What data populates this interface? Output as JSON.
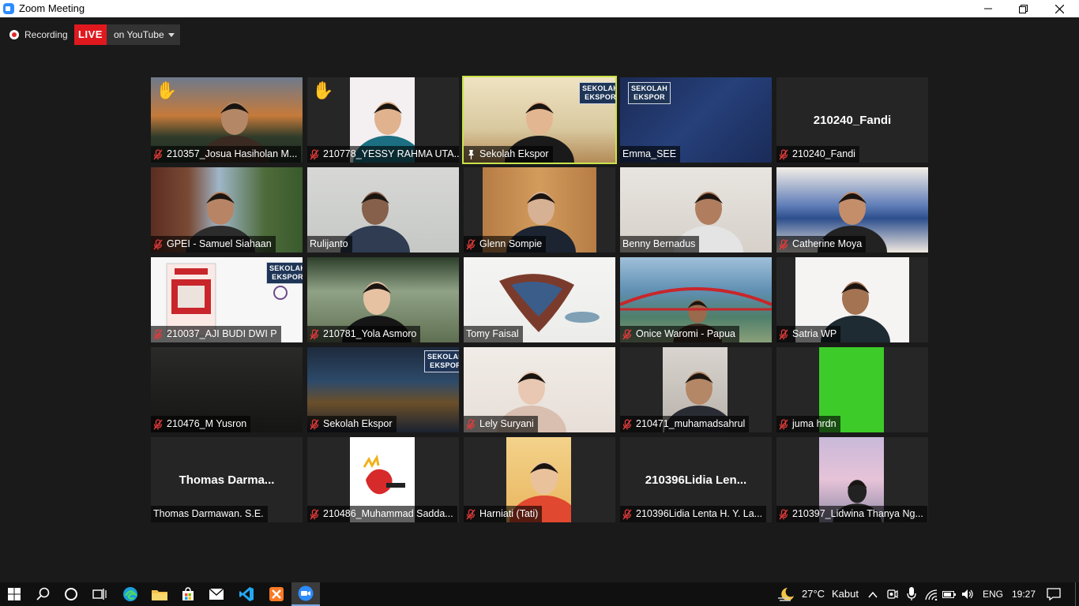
{
  "window": {
    "title": "Zoom Meeting"
  },
  "recording": {
    "label": "Recording",
    "live_badge": "LIVE",
    "stream_target": "on YouTube"
  },
  "tiles": [
    {
      "name": "210357_Josua Hasiholan M...",
      "muted": true,
      "hand_raised": true
    },
    {
      "name": "210778_YESSY RAHMA UTA...",
      "muted": true,
      "hand_raised": true
    },
    {
      "name": "Sekolah Ekspor",
      "pinned": true,
      "active_speaker": true,
      "watermark": [
        "SEKOLAH",
        "EKSPOR"
      ]
    },
    {
      "name": "Emma_SEE",
      "watermark": [
        "SEKOLAH",
        "EKSPOR"
      ]
    },
    {
      "name": "210240_Fandi",
      "muted": true,
      "video_off_label": "210240_Fandi"
    },
    {
      "name": "GPEI - Samuel Siahaan",
      "muted": true
    },
    {
      "name": "Rulijanto"
    },
    {
      "name": "Glenn Sompie",
      "muted": true
    },
    {
      "name": "Benny Bernadus"
    },
    {
      "name": "Catherine Moya",
      "muted": true
    },
    {
      "name": "210037_AJI BUDI DWI P",
      "muted": true,
      "watermark": [
        "SEKOLAH",
        "EKSPOR"
      ]
    },
    {
      "name": "210781_Yola Asmoro",
      "muted": true
    },
    {
      "name": "Tomy Faisal"
    },
    {
      "name": "Onice Waromi - Papua",
      "muted": true
    },
    {
      "name": "Satria WP",
      "muted": true
    },
    {
      "name": "210476_M Yusron",
      "muted": true
    },
    {
      "name": "Sekolah Ekspor",
      "muted": true,
      "watermark": [
        "SEKOLAH",
        "EKSPOR"
      ]
    },
    {
      "name": "Lely Suryani",
      "muted": true
    },
    {
      "name": "210471_muhamadsahrul",
      "muted": true
    },
    {
      "name": "juma hrdn",
      "muted": true
    },
    {
      "name": "Thomas Darmawan. S.E.",
      "video_off_label": "Thomas  Darma..."
    },
    {
      "name": "210486_Muhammad Sadda...",
      "muted": true
    },
    {
      "name": "Harniati (Tati)",
      "muted": true
    },
    {
      "name": "210396Lidia Lenta H. Y.  La...",
      "muted": true,
      "video_off_label": "210396Lidia Len..."
    },
    {
      "name": "210397_Lidwina Thanya Ng...",
      "muted": true
    }
  ],
  "taskbar": {
    "weather_temp": "27°C",
    "weather_text": "Kabut",
    "language": "ENG",
    "clock": "19:27"
  },
  "colors": {
    "live": "#e0191f",
    "active_speaker": "#c9e34a",
    "mute_icon": "#e23b3b"
  }
}
